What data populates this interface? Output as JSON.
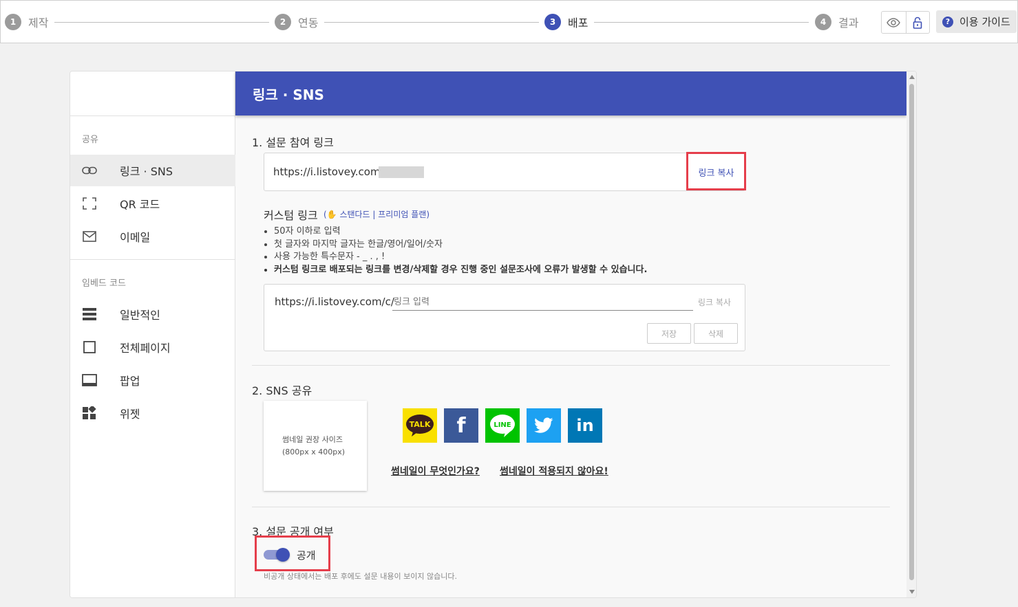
{
  "steps": [
    {
      "num": "1",
      "label": "제작"
    },
    {
      "num": "2",
      "label": "연동"
    },
    {
      "num": "3",
      "label": "배포"
    },
    {
      "num": "4",
      "label": "결과"
    }
  ],
  "toolbar": {
    "guide_label": "이용 가이드",
    "guide_icon_text": "?"
  },
  "sidebar": {
    "share_section": "공유",
    "embed_section": "임베드 코드",
    "share_items": [
      {
        "label": "링크 · SNS",
        "icon": "link-icon"
      },
      {
        "label": "QR 코드",
        "icon": "qr-icon"
      },
      {
        "label": "이메일",
        "icon": "mail-icon"
      }
    ],
    "embed_items": [
      {
        "label": "일반적인",
        "icon": "list-icon"
      },
      {
        "label": "전체페이지",
        "icon": "fullpage-icon"
      },
      {
        "label": "팝업",
        "icon": "popup-icon"
      },
      {
        "label": "위젯",
        "icon": "widget-icon"
      }
    ]
  },
  "main": {
    "header_title": "링크 · SNS",
    "section1_title": "1. 설문 참여 링크",
    "survey_link": "https://i.listovey.com/",
    "copy_link_label": "링크 복사",
    "custom_link_title": "커스텀 링크",
    "custom_plan_tag": "(✋ 스탠다드 | 프리미엄 플랜)",
    "custom_rules": [
      "50자 이하로 입력",
      "첫 글자와 마지막 글자는 한글/영어/일어/숫자",
      "사용 가능한 특수문자 - _ . , !",
      "커스텀 링크로 배포되는 링크를 변경/삭제할 경우 진행 중인 설문조사에 오류가 발생할 수 있습니다."
    ],
    "custom_prefix": "https://i.listovey.com/c/",
    "custom_placeholder": "링크 입력",
    "custom_copy_label": "링크 복사",
    "save_label": "저장",
    "delete_label": "삭제",
    "section2_title": "2. SNS 공유",
    "thumbnail_line1": "썸네일 권장 사이즈",
    "thumbnail_line2": "(800px x 400px)",
    "sns": [
      {
        "name": "kakaotalk",
        "text": "TALK",
        "color": "#f9e000"
      },
      {
        "name": "facebook",
        "text": "f",
        "color": "#3b5998"
      },
      {
        "name": "line",
        "text": "LINE",
        "color": "#00c300"
      },
      {
        "name": "twitter",
        "text": "",
        "color": "#1da1f2"
      },
      {
        "name": "linkedin",
        "text": "in",
        "color": "#0077b5"
      }
    ],
    "help_link1": "썸네일이 무엇인가요?",
    "help_link2": "썸네일이 적용되지 않아요!",
    "section3_title": "3. 설문 공개 여부",
    "toggle_label": "공개",
    "toggle_on": true,
    "hint": "비공개 상태에서는 배포 후에도 설문 내용이 보이지 않습니다."
  },
  "colors": {
    "accent": "#3f51b5",
    "highlight": "#e53e4b"
  }
}
